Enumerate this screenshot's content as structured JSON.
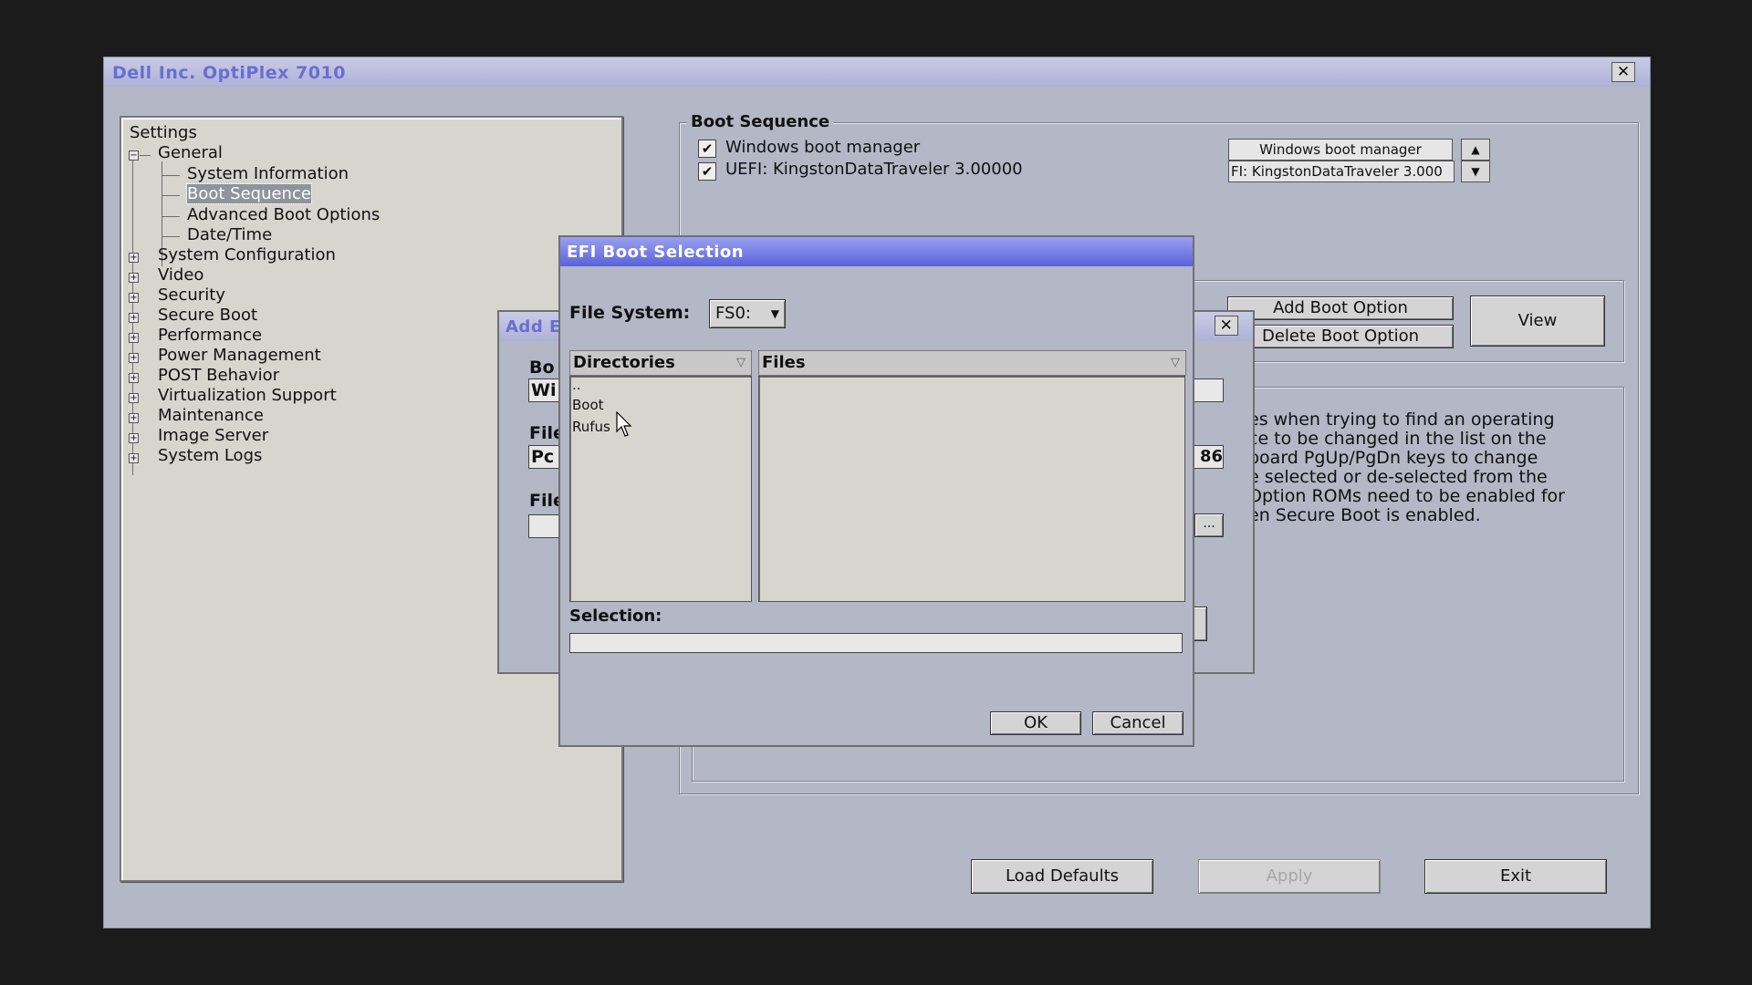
{
  "window": {
    "title": "Dell Inc. OptiPlex 7010"
  },
  "tree": {
    "root": "Settings",
    "general": "General",
    "general_children": [
      "System Information",
      "Boot Sequence",
      "Advanced Boot Options",
      "Date/Time"
    ],
    "groups": [
      "System Configuration",
      "Video",
      "Security",
      "Secure Boot",
      "Performance",
      "Power Management",
      "POST Behavior",
      "Virtualization Support",
      "Maintenance",
      "Image Server",
      "System Logs"
    ]
  },
  "boot_sequence": {
    "legend": "Boot Sequence",
    "items": [
      {
        "checked": true,
        "label": "Windows boot manager"
      },
      {
        "checked": true,
        "label": "UEFI: KingstonDataTraveler 3.00000"
      }
    ],
    "order_list": [
      "Windows boot manager",
      "FI: KingstonDataTraveler 3.000"
    ],
    "add_button": "Add Boot Option",
    "delete_button": "Delete Boot Option",
    "view_button": "View"
  },
  "help_lines": [
    "es when trying to find an operating",
    "ce to be changed in the list on the",
    "board PgUp/PgDn keys to change",
    "e selected or de-selected from the",
    "Option ROMs need to be enabled for",
    "en Secure Boot is enabled."
  ],
  "bottom_buttons": {
    "load_defaults": "Load Defaults",
    "apply": "Apply",
    "exit": "Exit"
  },
  "add_dialog": {
    "title_partial": "Add E",
    "label_bo": "Bo",
    "value_wi": "Wi",
    "label_file1": "File",
    "value_pc": "Pc",
    "value_86": "86",
    "label_file2": "File",
    "browse": "..."
  },
  "efi_dialog": {
    "title": "EFI Boot Selection",
    "file_system_label": "File System:",
    "file_system_value": "FS0:",
    "directories_header": "Directories",
    "files_header": "Files",
    "directories": [
      "..",
      "Boot",
      "Rufus"
    ],
    "selection_label": "Selection:",
    "selection_value": "",
    "ok": "OK",
    "cancel": "Cancel"
  }
}
